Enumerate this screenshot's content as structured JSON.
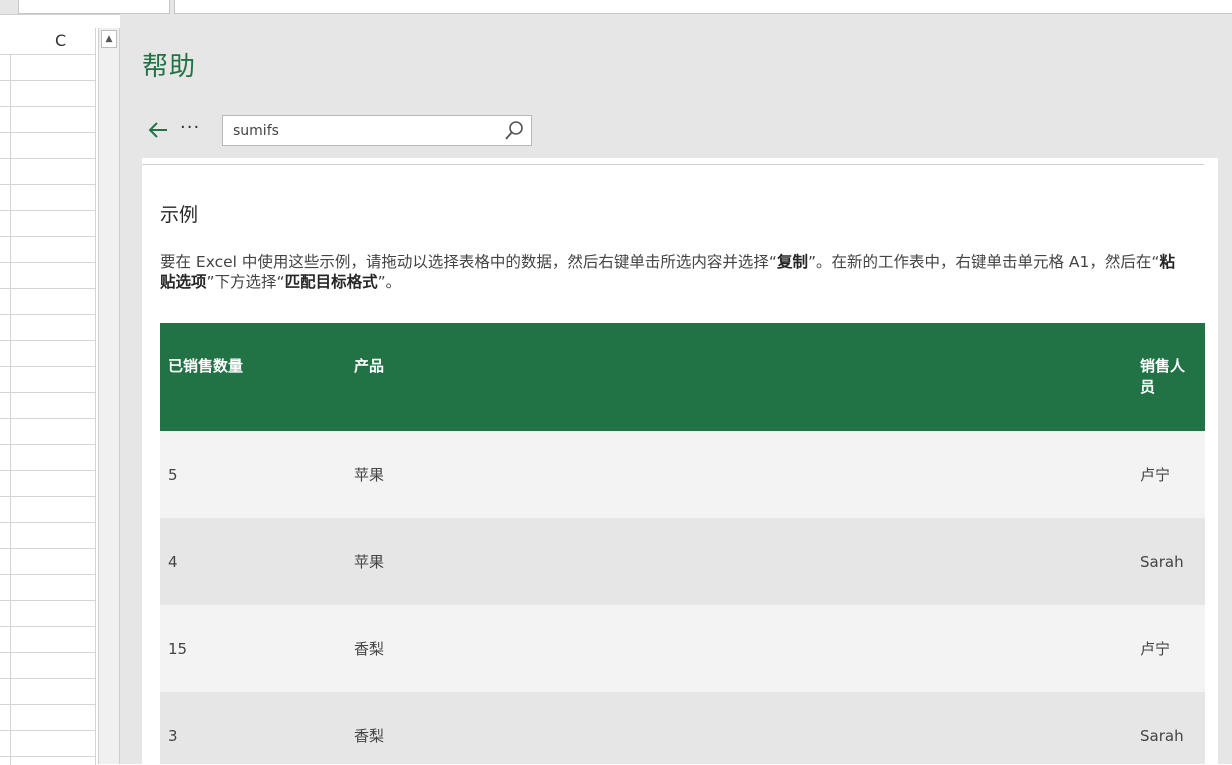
{
  "sheet": {
    "column_label": "C"
  },
  "help": {
    "title": "帮助",
    "search": {
      "value": "sumifs"
    }
  },
  "article": {
    "section_title": "示例",
    "instructions": {
      "p1": "要在 Excel 中使用这些示例，请拖动以选择表格中的数据，然后右键单击所选内容并选择“",
      "b1": "复制",
      "p2": "”。在新的工作表中，右键单击单元格 A1，然后在“",
      "b2": "粘贴选项",
      "p3": "”下方选择“",
      "b3": "匹配目标格式",
      "p4": "”。"
    },
    "table": {
      "headers": [
        "已销售数量",
        "产品",
        "销售人员"
      ],
      "rows": [
        [
          "5",
          "苹果",
          "卢宁"
        ],
        [
          "4",
          "苹果",
          "Sarah"
        ],
        [
          "15",
          "香梨",
          "卢宁"
        ],
        [
          "3",
          "香梨",
          "Sarah"
        ]
      ]
    }
  },
  "colors": {
    "accent": "#217346",
    "pane_bg": "#e6e6e6"
  }
}
